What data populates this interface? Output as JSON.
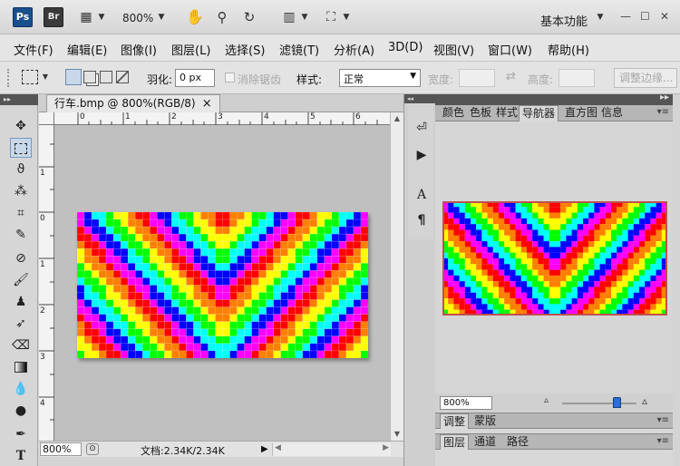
{
  "appbar": {
    "ps_logo": "Ps",
    "br_logo": "Br",
    "zoom_value": "800%",
    "workspace_label": "基本功能",
    "icons": [
      "film-icon",
      "hand-icon",
      "zoom-icon",
      "rotate-icon",
      "arrange-icon",
      "screen-mode-icon"
    ]
  },
  "menu": {
    "items": [
      "文件(F)",
      "编辑(E)",
      "图像(I)",
      "图层(L)",
      "选择(S)",
      "滤镜(T)",
      "分析(A)",
      "3D(D)",
      "视图(V)",
      "窗口(W)",
      "帮助(H)"
    ]
  },
  "options": {
    "feather_label": "羽化:",
    "feather_value": "0 px",
    "antialias_label": "消除锯齿",
    "style_label": "样式:",
    "style_value": "正常",
    "width_label": "宽度:",
    "height_label": "高度:",
    "refine_edge_label": "调整边缘..."
  },
  "document": {
    "tab_title": "行车.bmp @ 800%(RGB/8)",
    "tab_close": "×",
    "ruler_top": [
      "0",
      "1",
      "2",
      "3",
      "4",
      "5",
      "6"
    ],
    "ruler_left": [
      "1",
      "0",
      "1",
      "2",
      "3",
      "4"
    ],
    "status_zoom": "800%",
    "status_doc": "文档:2.34K/2.34K"
  },
  "collapsed_panels": {
    "icons": [
      "history-icon",
      "actions-icon",
      "character-icon",
      "paragraph-icon"
    ]
  },
  "panels": {
    "top_tabs": [
      "颜色",
      "色板",
      "样式",
      "导航器",
      "直方图",
      "信息"
    ],
    "active_tab": "导航器",
    "navigator_zoom": "800%",
    "adjust_tabs": [
      "调整",
      "蒙版"
    ],
    "layer_tabs": [
      "图层",
      "通道",
      "路径"
    ]
  },
  "colors": {
    "rainbow": [
      "#ff0000",
      "#ff7f00",
      "#ffff00",
      "#00ff00",
      "#00ffff",
      "#0000ff",
      "#ff00ff"
    ],
    "nav_border": "#c0504d",
    "slider_thumb": "#2a6fd6"
  }
}
